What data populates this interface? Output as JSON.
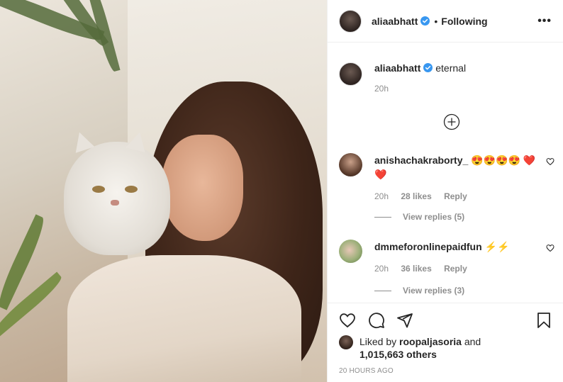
{
  "post": {
    "username": "aliaabhatt",
    "separator": "•",
    "follow_status": "Following",
    "more_label": "•••"
  },
  "caption": {
    "username": "aliaabhatt",
    "text": "eternal",
    "time": "20h"
  },
  "comments": [
    {
      "username": "anishachakraborty_",
      "text": "😍😍😍😍 ❤️❤️",
      "time": "20h",
      "likes": "28 likes",
      "reply_label": "Reply",
      "view_replies": "View replies (5)"
    },
    {
      "username": "dmmeforonlinepaidfun",
      "text": "⚡⚡",
      "time": "20h",
      "likes": "36 likes",
      "reply_label": "Reply",
      "view_replies": "View replies (3)"
    }
  ],
  "likes": {
    "prefix": "Liked by",
    "user": "roopaljasoria",
    "joiner": "and",
    "others": "1,015,663 others"
  },
  "posted_ago": "20 HOURS AGO",
  "colors": {
    "verified": "#3897f0",
    "muted": "#8e8e8e",
    "text": "#262626",
    "emoji_heart": "#e0245e"
  },
  "icons": [
    "verified-icon",
    "more-icon",
    "load-more-icon",
    "heart-icon",
    "comment-icon",
    "share-icon",
    "bookmark-icon"
  ]
}
